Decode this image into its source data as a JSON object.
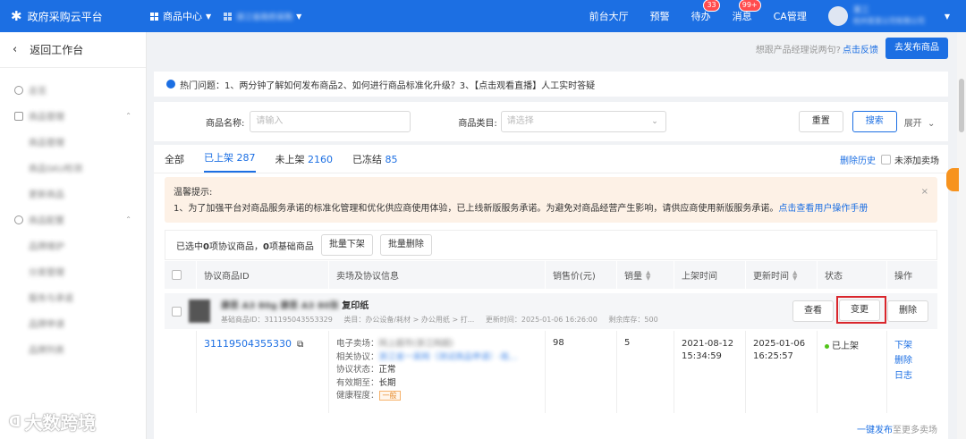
{
  "topbar": {
    "logo_text": "政府采购云平台",
    "product_center": "商品中心",
    "org_name": "浙江省政府采购",
    "links": [
      "前台大厅",
      "预警",
      "待办",
      "消息",
      "CA管理"
    ],
    "todo_badge": "33",
    "msg_badge": "99+",
    "user_name": "某三",
    "user_org": "杭州某某公司有限公司"
  },
  "sidebar": {
    "back_label": "返回工作台",
    "items": [
      {
        "label": "总览",
        "level": "top",
        "icon": "circle-icon"
      },
      {
        "label": "商品管理",
        "level": "top",
        "icon": "box-icon"
      },
      {
        "label": "商品管理",
        "level": "sub"
      },
      {
        "label": "商品SKU检测",
        "level": "sub"
      },
      {
        "label": "更新商品",
        "level": "sub"
      },
      {
        "label": "商品配置",
        "level": "top",
        "icon": "gear-icon"
      },
      {
        "label": "品牌维护",
        "level": "sub"
      },
      {
        "label": "分类管理",
        "level": "sub"
      },
      {
        "label": "服务与承诺",
        "level": "sub"
      },
      {
        "label": "品牌申请",
        "level": "sub"
      },
      {
        "label": "品牌列表",
        "level": "sub"
      }
    ]
  },
  "subheader": {
    "question": "想跟产品经理说两句?",
    "feedback": "点击反馈",
    "publish_button": "去发布商品"
  },
  "notice": "热门问题：1、两分钟了解如何发布商品2、如何进行商品标准化升级？3、【点击观看直播】人工实时答疑",
  "search": {
    "name_label": "商品名称:",
    "name_placeholder": "请输入",
    "category_label": "商品类目:",
    "category_placeholder": "请选择",
    "reset": "重置",
    "search": "搜索",
    "expand": "展开"
  },
  "tabs": [
    {
      "label": "全部",
      "count": ""
    },
    {
      "label": "已上架",
      "count": "287"
    },
    {
      "label": "未上架",
      "count": "2160"
    },
    {
      "label": "已冻结",
      "count": "85"
    }
  ],
  "tabs_right": {
    "history": "删除历史",
    "unadded": "未添加卖场"
  },
  "warning": {
    "title": "温馨提示:",
    "text": "1、为了加强平台对商品服务承诺的标准化管理和优化供应商使用体验，已上线新版服务承诺。为避免对商品经营产生影响，请供应商使用新版服务承诺。",
    "link": "点击查看用户操作手册"
  },
  "batch": {
    "selected_prefix": "已选中",
    "protocol_count": "0",
    "protocol_text": "项协议商品，",
    "base_count": "0",
    "base_text": "项基础商品",
    "offline": "批量下架",
    "delete": "批量删除"
  },
  "columns": [
    "协议商品ID",
    "卖场及协议信息",
    "销售价(元)",
    "销量",
    "上架时间",
    "更新时间",
    "状态",
    "操作"
  ],
  "group": {
    "title_blur": "康思 A3 80g 康思 A3 80张",
    "title": "复印纸",
    "base_id": "基础商品ID：311195043553329",
    "category": "类目：办公设备/耗材 > 办公用纸 > 打...",
    "updated": "更新时间：2025-01-06 16:26:00",
    "stock": "剩余库存：500",
    "view": "查看",
    "change": "变更",
    "delete": "删除"
  },
  "row": {
    "id": "31119504355330",
    "store_label": "电子卖场：",
    "store_value": "网上超市(浙江网超)",
    "protocol_label": "相关协议：",
    "protocol_value": "浙江省一采网（测试商品申请）-批...",
    "status_label": "协议状态：",
    "status_value": "正常",
    "valid_label": "有效期至：",
    "valid_value": "长期",
    "health_label": "健康程度：",
    "health_value": "一般",
    "price": "98",
    "sales": "5",
    "listed_date": "2021-08-12",
    "listed_time": "15:34:59",
    "updated_date": "2025-01-06",
    "updated_time": "16:25:57",
    "state": "已上架",
    "actions": [
      "下架",
      "删除",
      "日志"
    ]
  },
  "footer": {
    "link": "一键发布",
    "text": "至更多卖场"
  },
  "watermark": "大数跨境",
  "colors": {
    "primary": "#1c6fe3",
    "highlight": "#d9262c",
    "warning_bg": "#fdf1e6"
  }
}
